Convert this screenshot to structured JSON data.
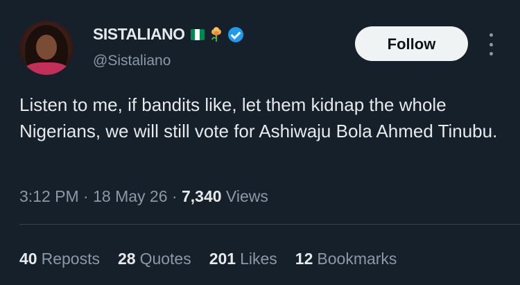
{
  "author": {
    "display_name": "SISTALIANO",
    "handle": "@Sistaliano"
  },
  "follow_label": "Follow",
  "tweet_text": "Listen to me, if bandits like, let them kidnap the whole Nigerians, we will still vote for Ashiwaju Bola Ahmed Tinubu.",
  "meta": {
    "time": "3:12 PM",
    "separator": "·",
    "date": "18 May 26",
    "views_count": "7,340",
    "views_label": "Views"
  },
  "stats": {
    "reposts_count": "40",
    "reposts_label": "Reposts",
    "quotes_count": "28",
    "quotes_label": "Quotes",
    "likes_count": "201",
    "likes_label": "Likes",
    "bookmarks_count": "12",
    "bookmarks_label": "Bookmarks"
  },
  "colors": {
    "background": "#15202b",
    "text_primary": "#e7e9ea",
    "text_secondary": "#8b98a5",
    "verified": "#1d9bf0",
    "follow_bg": "#eff3f4"
  },
  "icons": [
    "nigeria-flag-icon",
    "flower-icon",
    "verified-icon",
    "more-icon"
  ]
}
